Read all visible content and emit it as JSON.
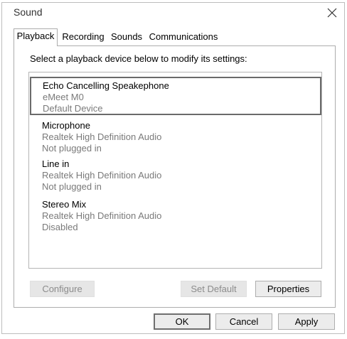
{
  "window": {
    "title": "Sound"
  },
  "tabs": [
    {
      "label": "Playback"
    },
    {
      "label": "Recording"
    },
    {
      "label": "Sounds"
    },
    {
      "label": "Communications"
    }
  ],
  "instruction": "Select a playback device below to modify its settings:",
  "devices": [
    {
      "name": "Echo Cancelling Speakephone",
      "detail": "eMeet M0",
      "status": "Default Device"
    },
    {
      "name": "Microphone",
      "detail": "Realtek High Definition Audio",
      "status": "Not plugged in"
    },
    {
      "name": "Line in",
      "detail": "Realtek High Definition Audio",
      "status": "Not plugged in"
    },
    {
      "name": "Stereo Mix",
      "detail": "Realtek High Definition Audio",
      "status": "Disabled"
    }
  ],
  "panel_buttons": {
    "configure": "Configure",
    "set_default": "Set Default",
    "properties": "Properties"
  },
  "dialog_buttons": {
    "ok": "OK",
    "cancel": "Cancel",
    "apply": "Apply"
  },
  "icons": {
    "close": "close-icon"
  }
}
